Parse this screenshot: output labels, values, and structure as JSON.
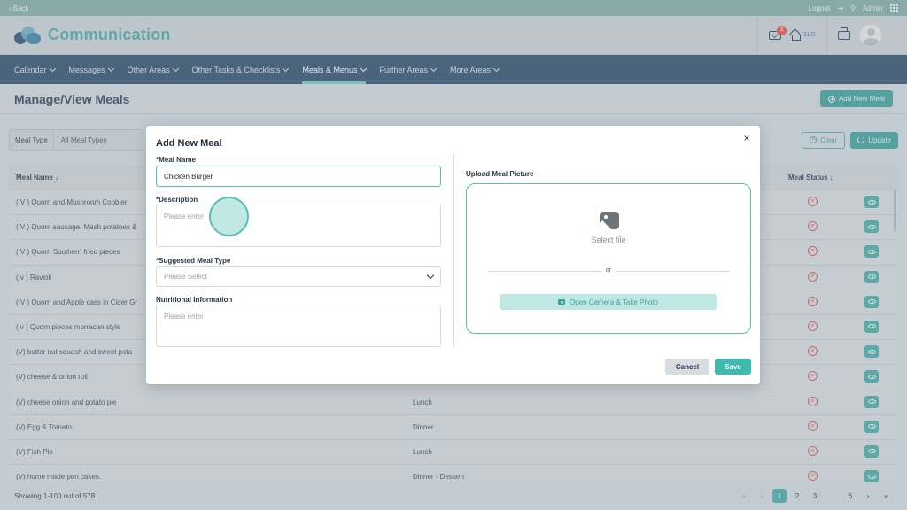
{
  "topbar": {
    "back_label": "‹ Back",
    "logout_label": "Logout",
    "admin_label": "Admin"
  },
  "header": {
    "app_title": "Communication",
    "mail_badge": "3",
    "home_label": "SLO"
  },
  "nav": {
    "items": [
      {
        "label": "Calendar"
      },
      {
        "label": "Messages"
      },
      {
        "label": "Other Areas"
      },
      {
        "label": "Other Tasks & Checklists"
      },
      {
        "label": "Meals & Menus"
      },
      {
        "label": "Further Areas"
      },
      {
        "label": "More Areas"
      }
    ],
    "active_index": 4
  },
  "page": {
    "title": "Manage/View Meals",
    "add_button": "Add New Meal"
  },
  "filter": {
    "label": "Meal Type",
    "value": "All Meal Types",
    "clear_label": "Clear",
    "update_label": "Update"
  },
  "table": {
    "headers": {
      "meal_name": "Meal Name ↓",
      "meal_status": "Meal Status ↓"
    },
    "rows": [
      {
        "name": "( V ) Quorn and Mushroom Cobbler",
        "type": ""
      },
      {
        "name": "( V ) Quorn sausage, Mash potatoes &",
        "type": ""
      },
      {
        "name": "( V ) Quorn Southern fried pieces",
        "type": ""
      },
      {
        "name": "( v ) Ravioli",
        "type": ""
      },
      {
        "name": "( V ) Quorn and Apple cass in Cider Gr",
        "type": ""
      },
      {
        "name": "( v ) Quorn pieces morracan style",
        "type": ""
      },
      {
        "name": "(V) butter nut squash and sweet pota",
        "type": ""
      },
      {
        "name": "(V) cheese & onion roll",
        "type": ""
      },
      {
        "name": "(V) cheese onion and potato pie",
        "type": "Lunch"
      },
      {
        "name": "(V) Egg & Tomato",
        "type": "Dinner"
      },
      {
        "name": "(V) Fish Pie",
        "type": "Lunch"
      },
      {
        "name": "(V) home made pan cakes.",
        "type": "Dinner - Dessert"
      }
    ]
  },
  "footer": {
    "showing": "Showing 1-100 out of 578",
    "pages": [
      "1",
      "2",
      "3",
      "...",
      "6"
    ],
    "active_page": "1"
  },
  "modal": {
    "title": "Add New Meal",
    "meal_name_label": "*Meal Name",
    "meal_name_value": "Chicken Burger",
    "description_label": "*Description",
    "description_placeholder": "Please enter",
    "meal_type_label": "*Suggested Meal Type",
    "meal_type_placeholder": "Please Select",
    "nutrition_label": "Nutritional Information",
    "nutrition_placeholder": "Please enter",
    "upload_label": "Upload Meal Picture",
    "select_file": "Select file",
    "or": "or",
    "camera_button": "Open Camera & Take Photo",
    "cancel": "Cancel",
    "save": "Save"
  },
  "colors": {
    "accent": "#3c9e98",
    "nav_bg": "#2f4d6b",
    "danger": "#d9534f"
  },
  "icons": [
    "grid-icon",
    "logout-icon",
    "search-icon",
    "mail-icon",
    "home-icon",
    "printer-icon",
    "avatar",
    "close-icon",
    "image-icon",
    "camera-icon",
    "eye-icon",
    "status-x-icon"
  ]
}
